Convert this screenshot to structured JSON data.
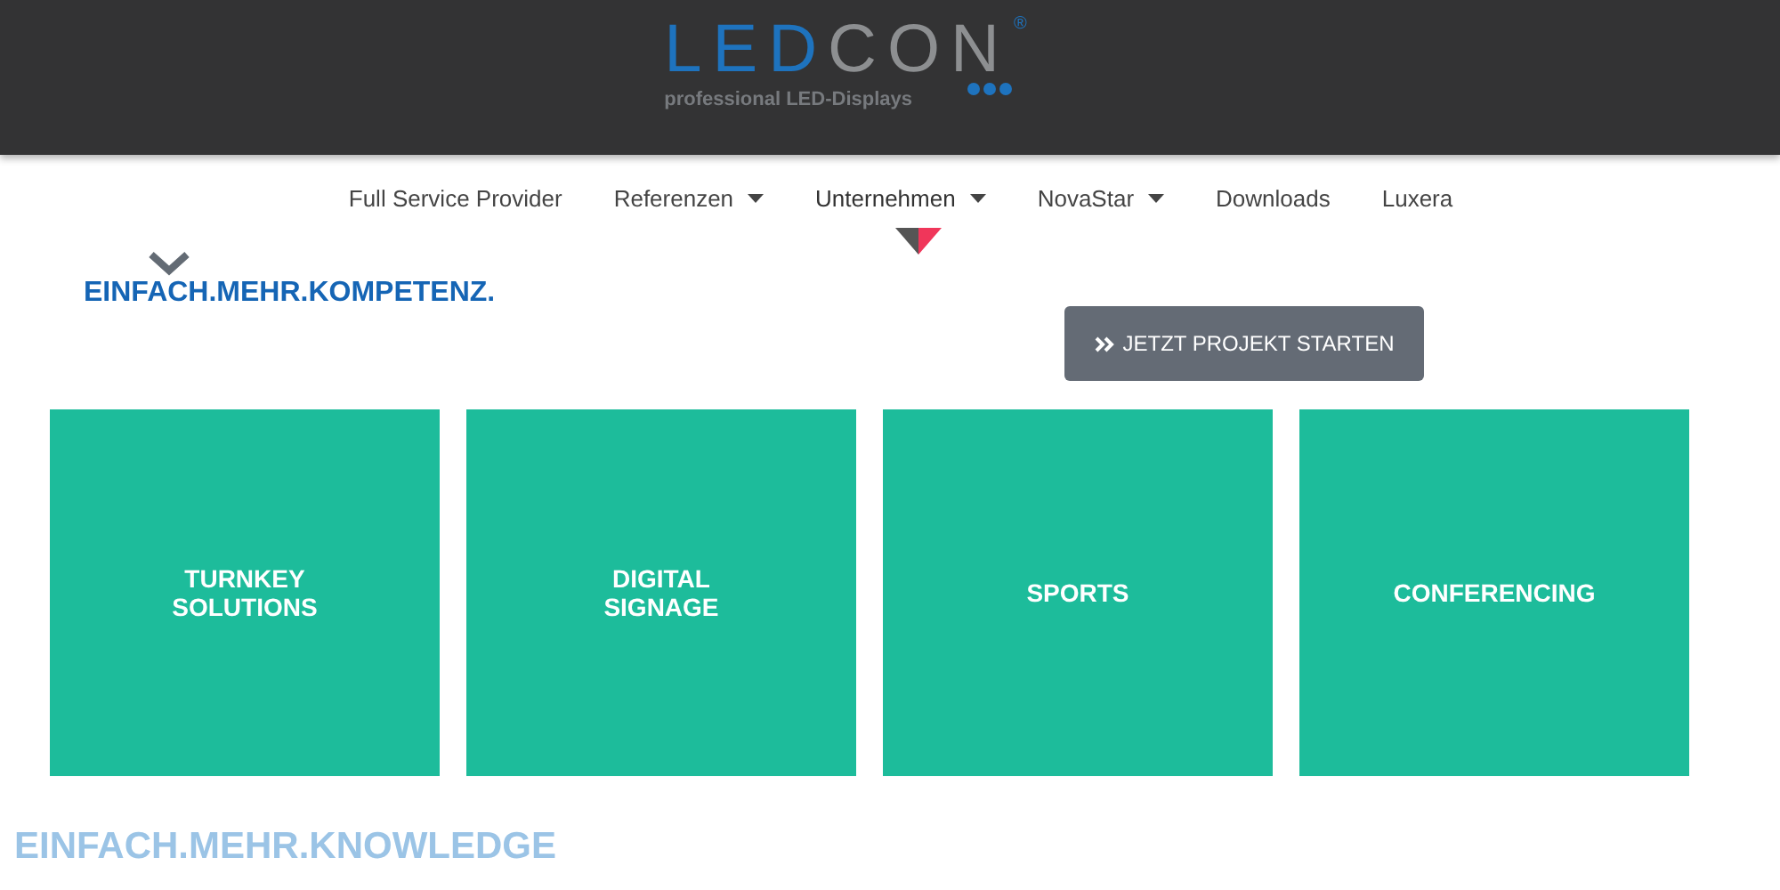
{
  "header": {
    "logo": {
      "part_1": "LED",
      "part_2": "CON",
      "registered": "®",
      "tagline": "professional LED-Displays"
    }
  },
  "nav": [
    {
      "label": "Full Service Provider",
      "has_dropdown": false,
      "selected": false
    },
    {
      "label": "Referenzen",
      "has_dropdown": true,
      "selected": false
    },
    {
      "label": "Unternehmen",
      "has_dropdown": true,
      "selected": true
    },
    {
      "label": "NovaStar",
      "has_dropdown": true,
      "selected": false
    },
    {
      "label": "Downloads",
      "has_dropdown": false,
      "selected": false
    },
    {
      "label": "Luxera",
      "has_dropdown": false,
      "selected": false
    }
  ],
  "intro": {
    "heading": "EINFACH.MEHR.KOMPETENZ.",
    "button": "JETZT PROJEKT STARTEN"
  },
  "tiles": [
    {
      "label": "TURNKEY SOLUTIONS"
    },
    {
      "label": "DIGITAL SIGNAGE"
    },
    {
      "label": "SPORTS"
    },
    {
      "label": "CONFERENCING"
    }
  ],
  "section_heading": "EINFACH.MEHR.KNOWLEDGE"
}
